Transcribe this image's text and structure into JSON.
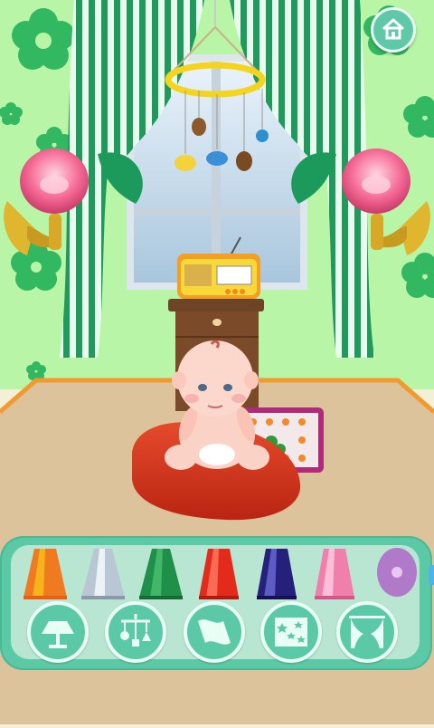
{
  "app": {
    "screen": "nursery-decorator"
  },
  "toolbar": {
    "home_icon": "home-icon",
    "lampshade_options": [
      {
        "name": "orange-lampshade",
        "color": "#f07a1f"
      },
      {
        "name": "silver-lampshade",
        "color": "#b9c6d3"
      },
      {
        "name": "green-lampshade",
        "color": "#1f8f4a"
      },
      {
        "name": "red-lampshade",
        "color": "#e32b1c"
      },
      {
        "name": "blue-lampshade",
        "color": "#25217a"
      },
      {
        "name": "pink-lampshade",
        "color": "#f07fab"
      },
      {
        "name": "purple-lampshade",
        "color": "#b07ac9"
      }
    ],
    "categories": [
      {
        "name": "lamp-category",
        "icon": "lamp-icon"
      },
      {
        "name": "mobile-category",
        "icon": "mobile-icon"
      },
      {
        "name": "flag-category",
        "icon": "flag-icon"
      },
      {
        "name": "pattern-category",
        "icon": "stars-icon"
      },
      {
        "name": "curtain-category",
        "icon": "curtain-icon"
      }
    ]
  },
  "colors": {
    "wall": "#b8f3a4",
    "curtain": "#1b9a5c",
    "floor": "#d9c19a",
    "panel": "#5cc9a6"
  }
}
